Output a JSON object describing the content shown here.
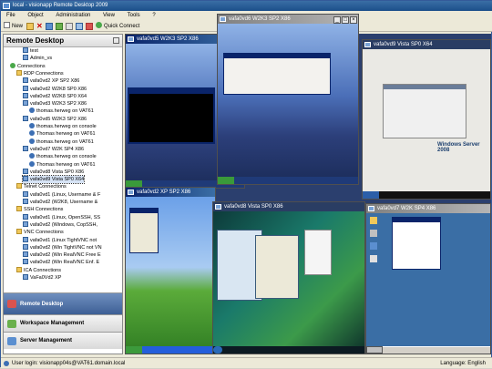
{
  "app": {
    "title": "local - visionapp Remote Desktop 2009",
    "colors": {
      "titlebar": "#1b4f8a",
      "selection": "#d6e3f5",
      "active_panel": "#3d5f95"
    }
  },
  "menu": [
    "File",
    "Object",
    "Administration",
    "View",
    "Tools",
    "?"
  ],
  "toolbar": {
    "new_label": "New",
    "quick_connect_label": "Quick Connect"
  },
  "sidebar": {
    "header": "Remote Desktop",
    "tree": [
      {
        "label": "test",
        "icon": "pc-icon",
        "indent": 3
      },
      {
        "label": "Admin_vs",
        "icon": "pc-icon",
        "indent": 3
      },
      {
        "label": "Connections",
        "icon": "globe-icon",
        "indent": 1
      },
      {
        "label": "RDP Connections",
        "icon": "folder-icon",
        "indent": 2
      },
      {
        "label": "vafa0vd2 XP SP2 X86",
        "icon": "pc-icon",
        "indent": 3
      },
      {
        "label": "vafa0vd2 W2K8 SP0 X86",
        "icon": "pc-icon",
        "indent": 3
      },
      {
        "label": "vafa0vd2 W2K8 SP0 X64",
        "icon": "pc-icon",
        "indent": 3
      },
      {
        "label": "vafa0vd3 W2K3 SP2 X86",
        "icon": "pc-icon",
        "indent": 3
      },
      {
        "label": "thomas.herweg on VAT61",
        "icon": "user-icon",
        "indent": 4
      },
      {
        "label": "vafa0vd5 W2K3 SP2 X86",
        "icon": "pc-icon",
        "indent": 3
      },
      {
        "label": "thomas.herweg on console",
        "icon": "user-icon",
        "indent": 4
      },
      {
        "label": "Thomas herweg on VAT61",
        "icon": "user-icon",
        "indent": 4
      },
      {
        "label": "thomas.herweg on VAT61",
        "icon": "user-icon",
        "indent": 4
      },
      {
        "label": "vafa0vd7 W2K SP4 X86",
        "icon": "pc-icon",
        "indent": 3
      },
      {
        "label": "thomas.herweg on console",
        "icon": "user-icon",
        "indent": 4
      },
      {
        "label": "Thomas herweg on VAT61",
        "icon": "user-icon",
        "indent": 4
      },
      {
        "label": "vafa0vd8 Vista SP0 X86",
        "icon": "pc-icon",
        "indent": 3
      },
      {
        "label": "vafa0vd9 Vista SP0 X64",
        "icon": "pc-icon",
        "indent": 3,
        "selected": true
      },
      {
        "label": "Telnet Connections",
        "icon": "folder-icon",
        "indent": 2
      },
      {
        "label": "vafa0vd1 (Linux, Username & F",
        "icon": "pc-icon",
        "indent": 3
      },
      {
        "label": "vafa0vd2 (W2K8, Username &",
        "icon": "pc-icon",
        "indent": 3
      },
      {
        "label": "SSH Connections",
        "icon": "folder-icon",
        "indent": 2
      },
      {
        "label": "vafa0vd1 (Linux, OpenSSH, SS",
        "icon": "pc-icon",
        "indent": 3
      },
      {
        "label": "vafa0vd2 (Windows, CopSSH,",
        "icon": "pc-icon",
        "indent": 3
      },
      {
        "label": "VNC Connections",
        "icon": "folder-icon",
        "indent": 2
      },
      {
        "label": "vafa0vd1 (Linux TightVNC not",
        "icon": "pc-icon",
        "indent": 3
      },
      {
        "label": "vafa0vd2 (Win TightVNC not VN",
        "icon": "pc-icon",
        "indent": 3
      },
      {
        "label": "vafa0vd2 (Win RealVNC Free E",
        "icon": "pc-icon",
        "indent": 3
      },
      {
        "label": "vafa0vd2 (Win RealVNC Enf. E",
        "icon": "pc-icon",
        "indent": 3
      },
      {
        "label": "ICA Connections",
        "icon": "folder-icon",
        "indent": 2
      },
      {
        "label": "VaFa0Vd2 XP",
        "icon": "pc-icon",
        "indent": 3
      }
    ],
    "panels": [
      "Remote Desktop",
      "Workspace Management",
      "Server Management"
    ]
  },
  "windows": [
    {
      "title": "vafa0vd5 W2K3 SP2 X86"
    },
    {
      "title": "vafa0vd6 W2K3 SP2 X86"
    },
    {
      "title": "vafa0vd9 Vista SP0 X64"
    },
    {
      "title": "vafa0vd2 XP SP2 X86"
    },
    {
      "title": "vafa0vd8 Vista SP0 X86"
    },
    {
      "title": "vafa0vd7 W2K SP4 X86"
    }
  ],
  "server_logo": "Windows Server 2008",
  "status": {
    "login": "User login: visionapp04s@VAT61.domain.local",
    "language": "Language: English"
  }
}
